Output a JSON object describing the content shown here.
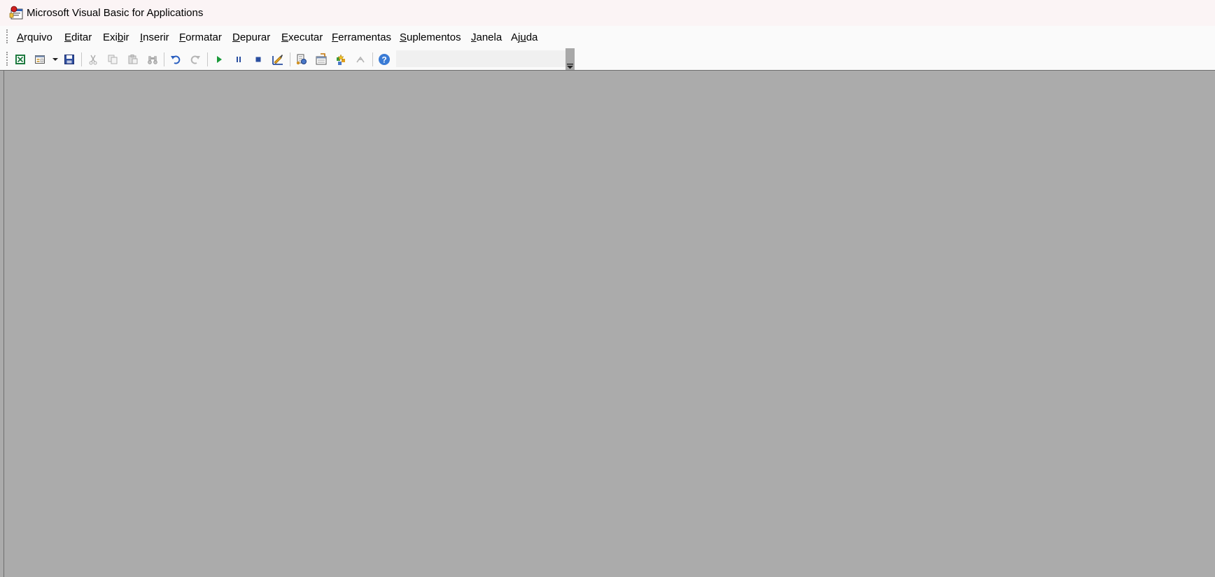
{
  "window": {
    "title": "Microsoft Visual Basic for Applications",
    "icon": "vba-app-icon"
  },
  "menubar": {
    "items": [
      {
        "id": "arquivo",
        "pre": "",
        "u": "A",
        "post": "rquivo"
      },
      {
        "id": "editar",
        "pre": "",
        "u": "E",
        "post": "ditar"
      },
      {
        "id": "exibir",
        "pre": "Exi",
        "u": "b",
        "post": "ir"
      },
      {
        "id": "inserir",
        "pre": "",
        "u": "I",
        "post": "nserir"
      },
      {
        "id": "formatar",
        "pre": "",
        "u": "F",
        "post": "ormatar"
      },
      {
        "id": "depurar",
        "pre": "",
        "u": "D",
        "post": "epurar"
      },
      {
        "id": "executar",
        "pre": "",
        "u": "E",
        "post": "xecutar"
      },
      {
        "id": "ferramentas",
        "pre": "",
        "u": "F",
        "post": "erramentas"
      },
      {
        "id": "suplementos",
        "pre": "",
        "u": "S",
        "post": "uplementos"
      },
      {
        "id": "janela",
        "pre": "",
        "u": "J",
        "post": "anela"
      },
      {
        "id": "ajuda",
        "pre": "Aj",
        "u": "u",
        "post": "da"
      }
    ]
  },
  "toolbar": {
    "buttons": [
      {
        "id": "view-excel",
        "icon": "excel-icon",
        "enabled": true
      },
      {
        "id": "insert-userform",
        "icon": "insert-form-icon",
        "enabled": true
      },
      {
        "id": "insert-dropdown",
        "icon": "dropdown-arrow-icon",
        "enabled": true
      },
      {
        "id": "save",
        "icon": "save-icon",
        "enabled": true
      },
      {
        "id": "cut",
        "icon": "cut-icon",
        "enabled": false
      },
      {
        "id": "copy",
        "icon": "copy-icon",
        "enabled": false
      },
      {
        "id": "paste",
        "icon": "paste-icon",
        "enabled": false
      },
      {
        "id": "find",
        "icon": "find-icon",
        "enabled": false
      },
      {
        "id": "undo",
        "icon": "undo-icon",
        "enabled": true
      },
      {
        "id": "redo",
        "icon": "redo-icon",
        "enabled": false
      },
      {
        "id": "run",
        "icon": "run-icon",
        "enabled": true
      },
      {
        "id": "break",
        "icon": "break-icon",
        "enabled": true
      },
      {
        "id": "reset",
        "icon": "reset-icon",
        "enabled": true
      },
      {
        "id": "design-mode",
        "icon": "design-mode-icon",
        "enabled": true
      },
      {
        "id": "project-explorer",
        "icon": "project-explorer-icon",
        "enabled": true
      },
      {
        "id": "properties-window",
        "icon": "properties-window-icon",
        "enabled": true
      },
      {
        "id": "object-browser",
        "icon": "object-browser-icon",
        "enabled": true
      },
      {
        "id": "toolbox",
        "icon": "toolbox-icon",
        "enabled": false
      },
      {
        "id": "help",
        "icon": "help-icon",
        "enabled": true
      }
    ],
    "position_combo_value": ""
  },
  "colors": {
    "titlebar_bg": "#fbf4f5",
    "workspace_bg": "#ababab",
    "run_green": "#1a9a3a",
    "help_blue": "#3a7bd5"
  }
}
